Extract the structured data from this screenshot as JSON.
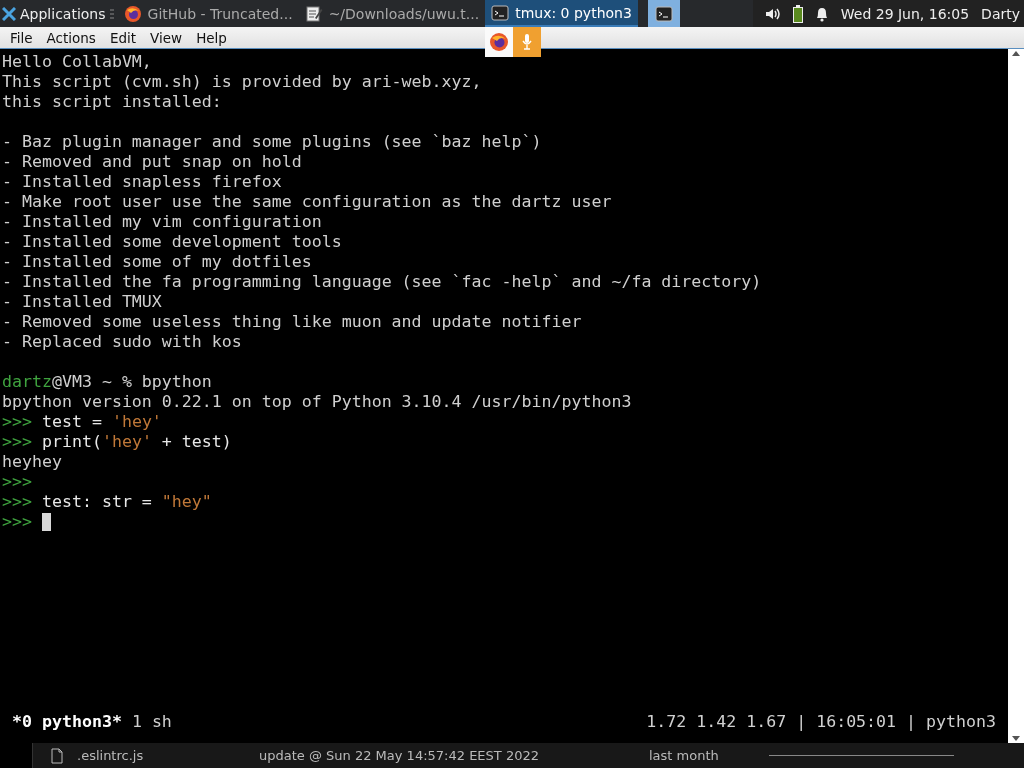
{
  "panel": {
    "apps_label": "Applications",
    "tasks": [
      {
        "label": "GitHub - Truncated...",
        "kind": "browser",
        "selected": false
      },
      {
        "label": "~/Downloads/uwu.t...",
        "kind": "editor",
        "selected": false
      },
      {
        "label": "tmux: 0 python3",
        "kind": "terminal",
        "selected": true
      }
    ],
    "clock": "Wed 29 Jun, 16:05",
    "user": "Darty"
  },
  "menu": [
    {
      "label": "File"
    },
    {
      "label": "Actions"
    },
    {
      "label": "Edit"
    },
    {
      "label": "View"
    },
    {
      "label": "Help"
    }
  ],
  "terminal": {
    "lines": [
      {
        "kind": "text",
        "segments": [
          {
            "kind": "text",
            "text": "Hello CollabVM,"
          }
        ]
      },
      {
        "kind": "text",
        "segments": [
          {
            "kind": "text",
            "text": "This script (cvm.sh) is provided by ari-web.xyz,"
          }
        ]
      },
      {
        "kind": "text",
        "segments": [
          {
            "kind": "text",
            "text": "this script installed:"
          }
        ]
      },
      {
        "kind": "blank"
      },
      {
        "kind": "text",
        "segments": [
          {
            "kind": "text",
            "text": "- Baz plugin manager and some plugins (see `baz help`)"
          }
        ]
      },
      {
        "kind": "text",
        "segments": [
          {
            "kind": "text",
            "text": "- Removed and put snap on hold"
          }
        ]
      },
      {
        "kind": "text",
        "segments": [
          {
            "kind": "text",
            "text": "- Installed snapless firefox"
          }
        ]
      },
      {
        "kind": "text",
        "segments": [
          {
            "kind": "text",
            "text": "- Make root user use the same configuration as the dartz user"
          }
        ]
      },
      {
        "kind": "text",
        "segments": [
          {
            "kind": "text",
            "text": "- Installed my vim configuration"
          }
        ]
      },
      {
        "kind": "text",
        "segments": [
          {
            "kind": "text",
            "text": "- Installed some development tools"
          }
        ]
      },
      {
        "kind": "text",
        "segments": [
          {
            "kind": "text",
            "text": "- Installed some of my dotfiles"
          }
        ]
      },
      {
        "kind": "text",
        "segments": [
          {
            "kind": "text",
            "text": "- Installed the fa programming language (see `fac -help` and ~/fa directory)"
          }
        ]
      },
      {
        "kind": "text",
        "segments": [
          {
            "kind": "text",
            "text": "- Installed TMUX"
          }
        ]
      },
      {
        "kind": "text",
        "segments": [
          {
            "kind": "text",
            "text": "- Removed some useless thing like muon and update notifier"
          }
        ]
      },
      {
        "kind": "text",
        "segments": [
          {
            "kind": "text",
            "text": "- Replaced sudo with kos"
          }
        ]
      },
      {
        "kind": "blank"
      },
      {
        "kind": "text",
        "segments": [
          {
            "kind": "user",
            "text": "dartz"
          },
          {
            "kind": "text",
            "text": "@VM3 ~ % bpython"
          }
        ]
      },
      {
        "kind": "text",
        "segments": [
          {
            "kind": "text",
            "text": "bpython version 0.22.1 on top of Python 3.10.4 /usr/bin/python3"
          }
        ]
      },
      {
        "kind": "text",
        "segments": [
          {
            "kind": "prompt",
            "text": ">>>"
          },
          {
            "kind": "code",
            "text": "test = "
          },
          {
            "kind": "string",
            "text": "'hey'"
          }
        ]
      },
      {
        "kind": "text",
        "segments": [
          {
            "kind": "prompt",
            "text": ">>>"
          },
          {
            "kind": "code",
            "text": "print("
          },
          {
            "kind": "string",
            "text": "'hey'"
          },
          {
            "kind": "code",
            "text": " + test)"
          }
        ]
      },
      {
        "kind": "text",
        "segments": [
          {
            "kind": "text",
            "text": "heyhey"
          }
        ]
      },
      {
        "kind": "text",
        "segments": [
          {
            "kind": "prompt",
            "text": ">>>"
          }
        ]
      },
      {
        "kind": "text",
        "segments": [
          {
            "kind": "prompt",
            "text": ">>>"
          },
          {
            "kind": "code",
            "text": "test: str = "
          },
          {
            "kind": "string",
            "text": "\"hey\""
          }
        ]
      },
      {
        "kind": "text",
        "cursor": true,
        "segments": [
          {
            "kind": "prompt",
            "text": ">>>"
          }
        ]
      }
    ],
    "status_left_bold": "*0 python3*",
    "status_left": "1 sh",
    "status_right": "1.72 1.42 1.67 | 16:05:01 | python3"
  },
  "behind": {
    "file": ".eslintrc.js",
    "commit": "update @ Sun 22 May 14:57:42 EEST 2022",
    "age": "last month"
  }
}
